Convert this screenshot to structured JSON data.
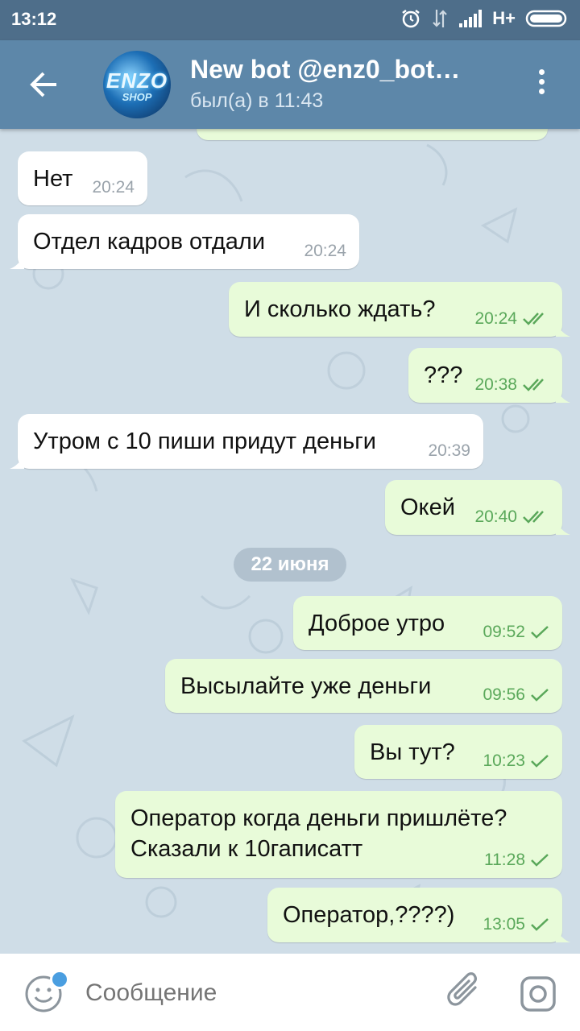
{
  "status_bar": {
    "time": "13:12",
    "network": "H+"
  },
  "header": {
    "title": "New bot @enz0_bot…",
    "subtitle": "был(а) в 11:43",
    "avatar_text": "ENZO",
    "avatar_subtext": "SHOP"
  },
  "messages": [
    {
      "dir": "in",
      "text": "Нет",
      "time": "20:24"
    },
    {
      "dir": "in",
      "text": "Отдел кадров отдали",
      "time": "20:24"
    },
    {
      "dir": "out",
      "text": "И сколько ждать?",
      "time": "20:24",
      "status": "read"
    },
    {
      "dir": "out",
      "text": "???",
      "time": "20:38",
      "status": "read"
    },
    {
      "dir": "in",
      "text": "Утром с 10 пиши придут деньги",
      "time": "20:39"
    },
    {
      "dir": "out",
      "text": "Окей",
      "time": "20:40",
      "status": "read"
    },
    {
      "dir": "out",
      "text": "Доброе утро",
      "time": "09:52",
      "status": "sent"
    },
    {
      "dir": "out",
      "text": "Высылайте уже деньги",
      "time": "09:56",
      "status": "sent"
    },
    {
      "dir": "out",
      "text": "Вы тут?",
      "time": "10:23",
      "status": "sent"
    },
    {
      "dir": "out",
      "text_line1": "Оператор когда деньги пришлёте?",
      "text_line2": "Сказали к 10гаписатт",
      "time": "11:28",
      "status": "sent"
    },
    {
      "dir": "out",
      "text": "Оператор,????)",
      "time": "13:05",
      "status": "sent"
    }
  ],
  "date_separator": "22 июня",
  "input": {
    "placeholder": "Сообщение"
  },
  "colors": {
    "header": "#5d87a9",
    "status_bar": "#4e6e8a",
    "outgoing_bubble": "#e8fbd9",
    "incoming_bubble": "#ffffff",
    "check": "#5aa85a"
  }
}
